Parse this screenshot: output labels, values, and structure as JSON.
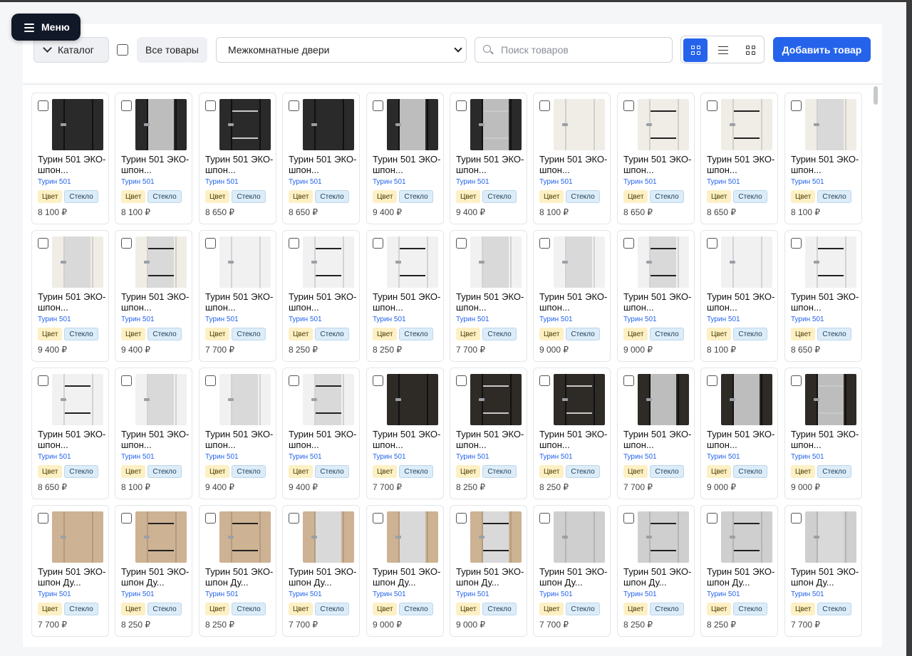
{
  "menu": {
    "label": "Меню"
  },
  "toolbar": {
    "catalog_label": "Каталог",
    "all_products_label": "Все товары",
    "category_selected": "Межкомнатные двери",
    "search_placeholder": "Поиск товаров",
    "add_product_label": "Добавить товар",
    "accent_color": "#2563eb"
  },
  "products": [
    {
      "name": "Турин 501 ЭКО-шпон...",
      "brand": "Турин 501",
      "tag_color": "Цвет",
      "tag_glass": "Стекло",
      "price": "8 100 ₽",
      "finish": "dark",
      "style": "plain"
    },
    {
      "name": "Турин 501 ЭКО-шпон...",
      "brand": "Турин 501",
      "tag_color": "Цвет",
      "tag_glass": "Стекло",
      "price": "8 100 ₽",
      "finish": "dark",
      "style": "glass"
    },
    {
      "name": "Турин 501 ЭКО-шпон...",
      "brand": "Турин 501",
      "tag_color": "Цвет",
      "tag_glass": "Стекло",
      "price": "8 650 ₽",
      "finish": "dark",
      "style": "lines"
    },
    {
      "name": "Турин 501 ЭКО-шпон...",
      "brand": "Турин 501",
      "tag_color": "Цвет",
      "tag_glass": "Стекло",
      "price": "8 650 ₽",
      "finish": "dark",
      "style": "plain"
    },
    {
      "name": "Турин 501 ЭКО-шпон...",
      "brand": "Турин 501",
      "tag_color": "Цвет",
      "tag_glass": "Стекло",
      "price": "9 400 ₽",
      "finish": "dark",
      "style": "glass"
    },
    {
      "name": "Турин 501 ЭКО-шпон...",
      "brand": "Турин 501",
      "tag_color": "Цвет",
      "tag_glass": "Стекло",
      "price": "9 400 ₽",
      "finish": "dark",
      "style": "glasslines"
    },
    {
      "name": "Турин 501 ЭКО-шпон...",
      "brand": "Турин 501",
      "tag_color": "Цвет",
      "tag_glass": "Стекло",
      "price": "8 100 ₽",
      "finish": "cream",
      "style": "plain"
    },
    {
      "name": "Турин 501 ЭКО-шпон...",
      "brand": "Турин 501",
      "tag_color": "Цвет",
      "tag_glass": "Стекло",
      "price": "8 650 ₽",
      "finish": "cream",
      "style": "lines"
    },
    {
      "name": "Турин 501 ЭКО-шпон...",
      "brand": "Турин 501",
      "tag_color": "Цвет",
      "tag_glass": "Стекло",
      "price": "8 650 ₽",
      "finish": "cream",
      "style": "lines"
    },
    {
      "name": "Турин 501 ЭКО-шпон...",
      "brand": "Турин 501",
      "tag_color": "Цвет",
      "tag_glass": "Стекло",
      "price": "8 100 ₽",
      "finish": "cream",
      "style": "glass"
    },
    {
      "name": "Турин 501 ЭКО-шпон...",
      "brand": "Турин 501",
      "tag_color": "Цвет",
      "tag_glass": "Стекло",
      "price": "9 400 ₽",
      "finish": "cream",
      "style": "glass"
    },
    {
      "name": "Турин 501 ЭКО-шпон...",
      "brand": "Турин 501",
      "tag_color": "Цвет",
      "tag_glass": "Стекло",
      "price": "9 400 ₽",
      "finish": "cream",
      "style": "glasslines"
    },
    {
      "name": "Турин 501 ЭКО-шпон...",
      "brand": "Турин 501",
      "tag_color": "Цвет",
      "tag_glass": "Стекло",
      "price": "7 700 ₽",
      "finish": "white",
      "style": "plain"
    },
    {
      "name": "Турин 501 ЭКО-шпон...",
      "brand": "Турин 501",
      "tag_color": "Цвет",
      "tag_glass": "Стекло",
      "price": "8 250 ₽",
      "finish": "white",
      "style": "lines"
    },
    {
      "name": "Турин 501 ЭКО-шпон...",
      "brand": "Турин 501",
      "tag_color": "Цвет",
      "tag_glass": "Стекло",
      "price": "8 250 ₽",
      "finish": "white",
      "style": "lines"
    },
    {
      "name": "Турин 501 ЭКО-шпон...",
      "brand": "Турин 501",
      "tag_color": "Цвет",
      "tag_glass": "Стекло",
      "price": "7 700 ₽",
      "finish": "white",
      "style": "glass"
    },
    {
      "name": "Турин 501 ЭКО-шпон...",
      "brand": "Турин 501",
      "tag_color": "Цвет",
      "tag_glass": "Стекло",
      "price": "9 000 ₽",
      "finish": "white",
      "style": "glass"
    },
    {
      "name": "Турин 501 ЭКО-шпон...",
      "brand": "Турин 501",
      "tag_color": "Цвет",
      "tag_glass": "Стекло",
      "price": "9 000 ₽",
      "finish": "white",
      "style": "glasslines"
    },
    {
      "name": "Турин 501 ЭКО-шпон...",
      "brand": "Турин 501",
      "tag_color": "Цвет",
      "tag_glass": "Стекло",
      "price": "8 100 ₽",
      "finish": "white",
      "style": "plain"
    },
    {
      "name": "Турин 501 ЭКО-шпон...",
      "brand": "Турин 501",
      "tag_color": "Цвет",
      "tag_glass": "Стекло",
      "price": "8 650 ₽",
      "finish": "white",
      "style": "lines"
    },
    {
      "name": "Турин 501 ЭКО-шпон...",
      "brand": "Турин 501",
      "tag_color": "Цвет",
      "tag_glass": "Стекло",
      "price": "8 650 ₽",
      "finish": "white",
      "style": "lines"
    },
    {
      "name": "Турин 501 ЭКО-шпон...",
      "brand": "Турин 501",
      "tag_color": "Цвет",
      "tag_glass": "Стекло",
      "price": "8 100 ₽",
      "finish": "white",
      "style": "glass"
    },
    {
      "name": "Турин 501 ЭКО-шпон...",
      "brand": "Турин 501",
      "tag_color": "Цвет",
      "tag_glass": "Стекло",
      "price": "9 400 ₽",
      "finish": "white",
      "style": "glass"
    },
    {
      "name": "Турин 501 ЭКО-шпон...",
      "brand": "Турин 501",
      "tag_color": "Цвет",
      "tag_glass": "Стекло",
      "price": "9 400 ₽",
      "finish": "white",
      "style": "glasslines"
    },
    {
      "name": "Турин 501 ЭКО-шпон...",
      "brand": "Турин 501",
      "tag_color": "Цвет",
      "tag_glass": "Стекло",
      "price": "7 700 ₽",
      "finish": "wenge",
      "style": "plain"
    },
    {
      "name": "Турин 501 ЭКО-шпон...",
      "brand": "Турин 501",
      "tag_color": "Цвет",
      "tag_glass": "Стекло",
      "price": "8 250 ₽",
      "finish": "wenge",
      "style": "lines"
    },
    {
      "name": "Турин 501 ЭКО-шпон...",
      "brand": "Турин 501",
      "tag_color": "Цвет",
      "tag_glass": "Стекло",
      "price": "8 250 ₽",
      "finish": "wenge",
      "style": "lines"
    },
    {
      "name": "Турин 501 ЭКО-шпон...",
      "brand": "Турин 501",
      "tag_color": "Цвет",
      "tag_glass": "Стекло",
      "price": "7 700 ₽",
      "finish": "wenge",
      "style": "glass"
    },
    {
      "name": "Турин 501 ЭКО-шпон...",
      "brand": "Турин 501",
      "tag_color": "Цвет",
      "tag_glass": "Стекло",
      "price": "9 000 ₽",
      "finish": "wenge",
      "style": "glass"
    },
    {
      "name": "Турин 501 ЭКО-шпон...",
      "brand": "Турин 501",
      "tag_color": "Цвет",
      "tag_glass": "Стекло",
      "price": "9 000 ₽",
      "finish": "wenge",
      "style": "glasslines"
    },
    {
      "name": "Турин 501 ЭКО-шпон Ду...",
      "brand": "Турин 501",
      "tag_color": "Цвет",
      "tag_glass": "Стекло",
      "price": "7 700 ₽",
      "finish": "oak",
      "style": "plain"
    },
    {
      "name": "Турин 501 ЭКО-шпон Ду...",
      "brand": "Турин 501",
      "tag_color": "Цвет",
      "tag_glass": "Стекло",
      "price": "8 250 ₽",
      "finish": "oak",
      "style": "lines"
    },
    {
      "name": "Турин 501 ЭКО-шпон Ду...",
      "brand": "Турин 501",
      "tag_color": "Цвет",
      "tag_glass": "Стекло",
      "price": "8 250 ₽",
      "finish": "oak",
      "style": "lines"
    },
    {
      "name": "Турин 501 ЭКО-шпон Ду...",
      "brand": "Турин 501",
      "tag_color": "Цвет",
      "tag_glass": "Стекло",
      "price": "7 700 ₽",
      "finish": "oak",
      "style": "glass"
    },
    {
      "name": "Турин 501 ЭКО-шпон Ду...",
      "brand": "Турин 501",
      "tag_color": "Цвет",
      "tag_glass": "Стекло",
      "price": "9 000 ₽",
      "finish": "oak",
      "style": "glass"
    },
    {
      "name": "Турин 501 ЭКО-шпон Ду...",
      "brand": "Турин 501",
      "tag_color": "Цвет",
      "tag_glass": "Стекло",
      "price": "9 000 ₽",
      "finish": "oak",
      "style": "glasslines"
    },
    {
      "name": "Турин 501 ЭКО-шпон Ду...",
      "brand": "Турин 501",
      "tag_color": "Цвет",
      "tag_glass": "Стекло",
      "price": "7 700 ₽",
      "finish": "grey",
      "style": "plain"
    },
    {
      "name": "Турин 501 ЭКО-шпон Ду...",
      "brand": "Турин 501",
      "tag_color": "Цвет",
      "tag_glass": "Стекло",
      "price": "8 250 ₽",
      "finish": "grey",
      "style": "lines"
    },
    {
      "name": "Турин 501 ЭКО-шпон Ду...",
      "brand": "Турин 501",
      "tag_color": "Цвет",
      "tag_glass": "Стекло",
      "price": "8 250 ₽",
      "finish": "grey",
      "style": "lines"
    },
    {
      "name": "Турин 501 ЭКО-шпон Ду...",
      "brand": "Турин 501",
      "tag_color": "Цвет",
      "tag_glass": "Стекло",
      "price": "7 700 ₽",
      "finish": "grey",
      "style": "glass"
    }
  ],
  "finish_colors": {
    "dark": "#2a2a2a",
    "cream": "#efede6",
    "white": "#f1f1f1",
    "wenge": "#2e2a26",
    "oak": "#cdb293",
    "grey": "#cfcfcf"
  }
}
